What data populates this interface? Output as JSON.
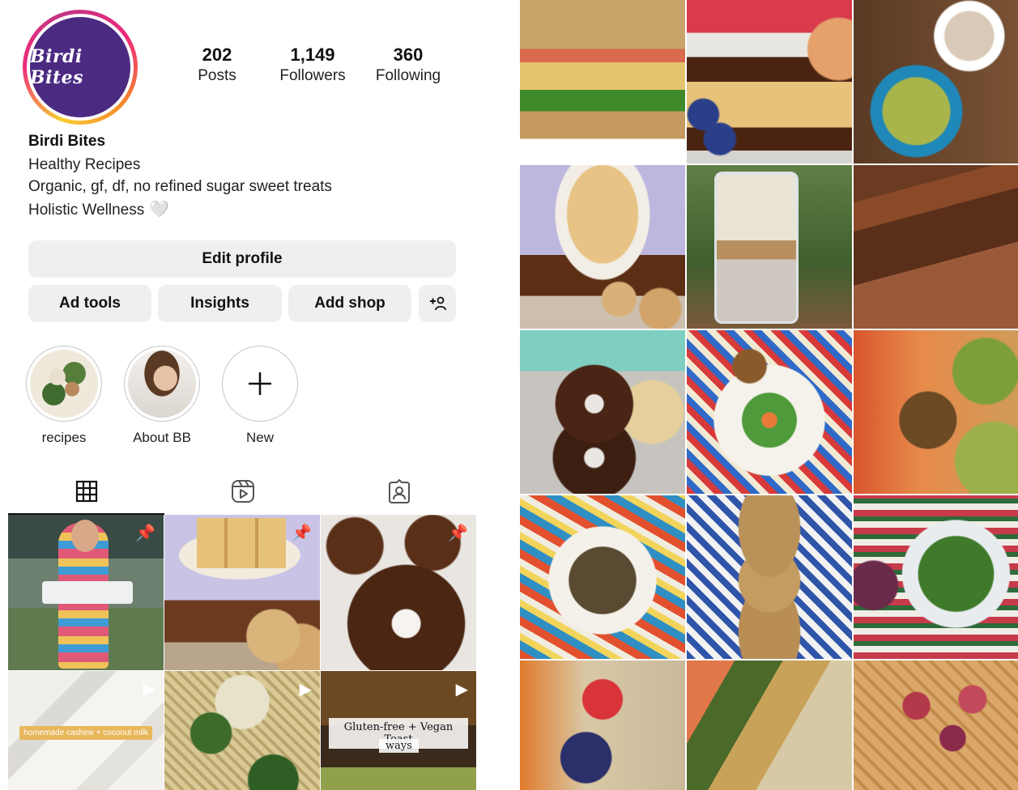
{
  "profile": {
    "avatar_logo": "Birdi Bites",
    "stats": [
      {
        "value": "202",
        "label": "Posts"
      },
      {
        "value": "1,149",
        "label": "Followers"
      },
      {
        "value": "360",
        "label": "Following"
      }
    ],
    "name": "Birdi Bites",
    "bio": [
      "Healthy Recipes",
      "Organic, gf, df, no refined sugar sweet treats",
      "Holistic Wellness"
    ],
    "bio_emoji": "🤍",
    "buttons": {
      "edit_profile": "Edit profile",
      "ad_tools": "Ad tools",
      "insights": "Insights",
      "add_shop": "Add shop",
      "add_person_icon": "+⑀"
    },
    "highlights": [
      {
        "label": "recipes"
      },
      {
        "label": "About BB"
      },
      {
        "label": "New",
        "icon": "plus-icon"
      }
    ],
    "tabs": [
      "grid-icon",
      "reels-icon",
      "tagged-icon"
    ],
    "posts": [
      {
        "badge": "pin-icon"
      },
      {
        "badge": "pin-icon"
      },
      {
        "badge": "pin-icon"
      },
      {
        "badge": "reel-icon",
        "caption": "homemade cashew + coconut milk"
      },
      {
        "badge": "reel-icon"
      },
      {
        "badge": "reel-icon",
        "caption_top": "Gluten-free + Vegan Toast",
        "caption_bottom": "ways"
      }
    ]
  },
  "colors": {
    "avatar_purple": "#4b2a82",
    "button_gray": "#efefef",
    "text": "#111111"
  }
}
